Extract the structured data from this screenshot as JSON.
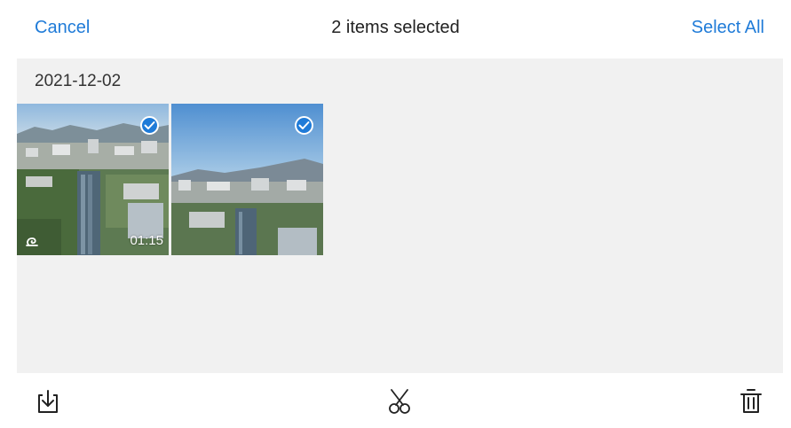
{
  "header": {
    "cancel_label": "Cancel",
    "title": "2 items selected",
    "select_all_label": "Select All"
  },
  "gallery": {
    "date": "2021-12-02",
    "items": [
      {
        "type": "video",
        "duration": "01:15",
        "selected": true,
        "icon": "motion-icon"
      },
      {
        "type": "photo",
        "selected": true
      }
    ]
  },
  "toolbar": {
    "icons": [
      "download-icon",
      "scissors-icon",
      "trash-icon"
    ]
  },
  "colors": {
    "accent": "#1f7bd8",
    "background": "#f1f1f1"
  }
}
